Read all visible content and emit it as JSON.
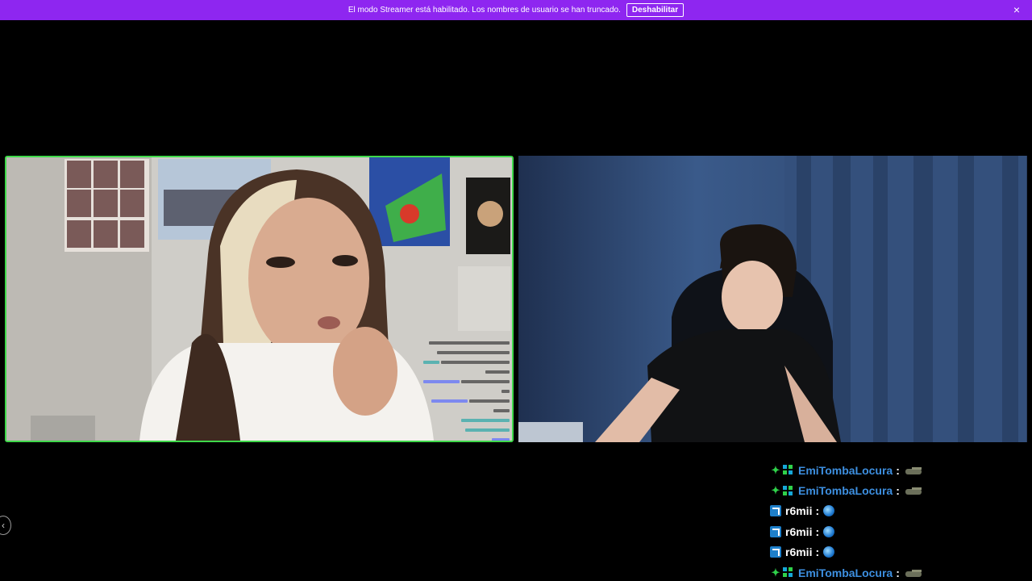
{
  "banner": {
    "text": "El modo Streamer está habilitado. Los nombres de usuario se han truncado.",
    "button_label": "Deshabilitar",
    "close_icon": "×",
    "color": "#8e26f0"
  },
  "video_left": {
    "border_color": "#3fd94a",
    "overlay_chat_lines": 12
  },
  "video_right": {},
  "side_nav": {
    "icon": "‹"
  },
  "chat": {
    "messages": [
      {
        "badges": [
          "sparkle",
          "gift"
        ],
        "user": "EmiTombaLocura",
        "user_color": "#3d8fe0",
        "emote": "tank-emote"
      },
      {
        "badges": [
          "sparkle",
          "gift"
        ],
        "user": "EmiTombaLocura",
        "user_color": "#3d8fe0",
        "emote": "tank-emote"
      },
      {
        "badges": [
          "blue-square"
        ],
        "user": "r6mii",
        "user_color": "#ffffff",
        "emote": "globe-emote"
      },
      {
        "badges": [
          "blue-square"
        ],
        "user": "r6mii",
        "user_color": "#ffffff",
        "emote": "globe-emote"
      },
      {
        "badges": [
          "blue-square"
        ],
        "user": "r6mii",
        "user_color": "#ffffff",
        "emote": "globe-emote"
      },
      {
        "badges": [
          "sparkle",
          "gift"
        ],
        "user": "EmiTombaLocura",
        "user_color": "#3d8fe0",
        "emote": "tank-emote"
      }
    ],
    "separator": ":"
  }
}
